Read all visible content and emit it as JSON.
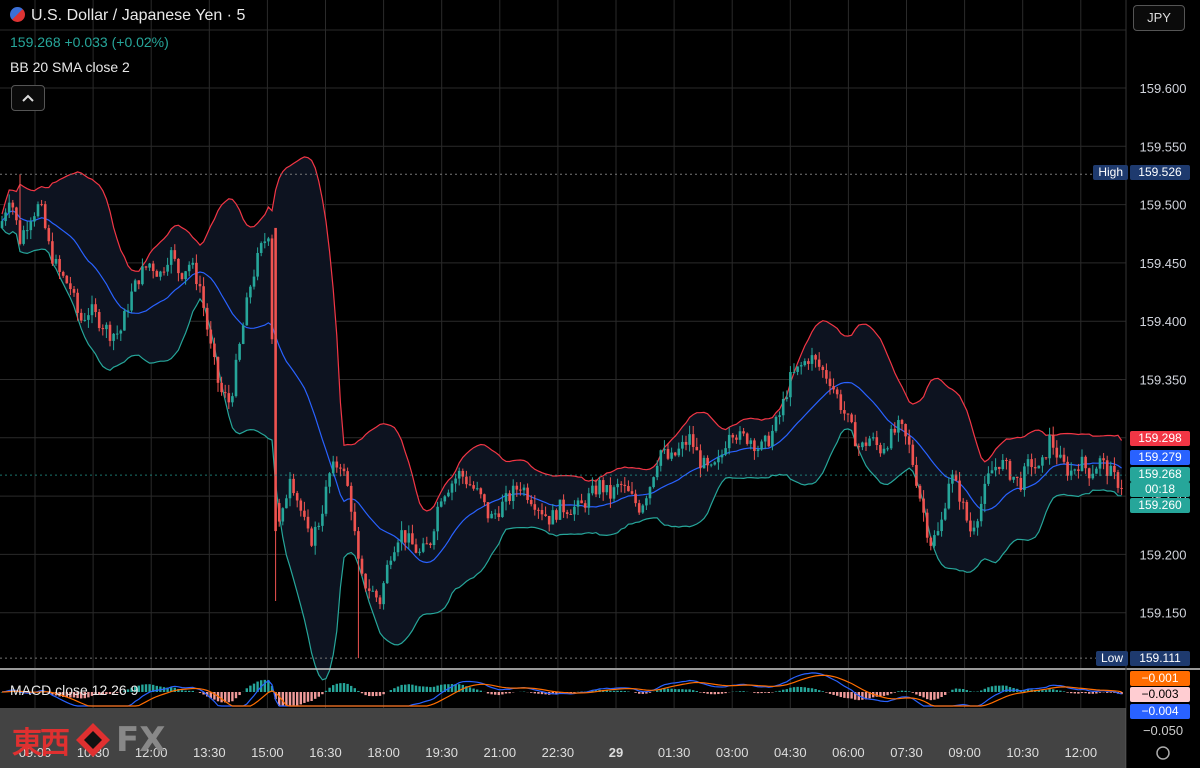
{
  "header": {
    "symbol": "U.S. Dollar / Japanese Yen · 5",
    "price": "159.268",
    "change": "+0.033 (+0.02%)",
    "indicator": "BB 20 SMA close 2",
    "collapse_icon": "chevron-up-icon"
  },
  "currency_button": "JPY",
  "watermark": {
    "kanji": "東西",
    "text": "FX"
  },
  "colors": {
    "up": "#26a69a",
    "down": "#ef5350",
    "upper_band": "#f23645",
    "lower_band": "#26a69a",
    "basis": "#2962ff",
    "macd": "#2962ff",
    "signal": "#ff6d00"
  },
  "chart_data": [
    {
      "type": "candlestick",
      "title": "U.S. Dollar / Japanese Yen · 5",
      "ylim": [
        159.1,
        159.64
      ],
      "y_ticks": [
        "159.600",
        "159.550",
        "159.500",
        "159.450",
        "159.400",
        "159.350",
        "159.300",
        "159.250",
        "159.200",
        "159.150"
      ],
      "x_ticks": [
        "09:00",
        "10:30",
        "12:00",
        "13:30",
        "15:00",
        "16:30",
        "18:00",
        "19:30",
        "21:00",
        "22:30",
        "29",
        "01:30",
        "03:00",
        "04:30",
        "06:00",
        "07:30",
        "09:00",
        "10:30",
        "12:00"
      ],
      "high": {
        "label": "High",
        "value": "159.526"
      },
      "low": {
        "label": "Low",
        "value": "159.111"
      },
      "price_labels": {
        "upper_band": "159.298",
        "basis": "159.279",
        "last": "159.268",
        "countdown": "00:18",
        "lower_band": "159.260"
      },
      "close_path": [
        [
          0,
          159.48
        ],
        [
          10,
          159.51
        ],
        [
          20,
          159.47
        ],
        [
          30,
          159.49
        ],
        [
          40,
          159.5
        ],
        [
          50,
          159.46
        ],
        [
          60,
          159.44
        ],
        [
          70,
          159.43
        ],
        [
          80,
          159.4
        ],
        [
          90,
          159.41
        ],
        [
          100,
          159.4
        ],
        [
          110,
          159.39
        ],
        [
          120,
          159.39
        ],
        [
          130,
          159.42
        ],
        [
          140,
          159.44
        ],
        [
          150,
          159.45
        ],
        [
          160,
          159.44
        ],
        [
          170,
          159.46
        ],
        [
          180,
          159.44
        ],
        [
          190,
          159.45
        ],
        [
          200,
          159.43
        ],
        [
          210,
          159.38
        ],
        [
          220,
          159.34
        ],
        [
          230,
          159.33
        ],
        [
          240,
          159.38
        ],
        [
          250,
          159.43
        ],
        [
          260,
          159.46
        ],
        [
          270,
          159.48
        ],
        [
          275,
          159.25
        ],
        [
          280,
          159.22
        ],
        [
          290,
          159.27
        ],
        [
          300,
          159.24
        ],
        [
          310,
          159.21
        ],
        [
          320,
          159.23
        ],
        [
          330,
          159.27
        ],
        [
          340,
          159.28
        ],
        [
          350,
          159.25
        ],
        [
          360,
          159.18
        ],
        [
          370,
          159.17
        ],
        [
          380,
          159.16
        ],
        [
          390,
          159.2
        ],
        [
          400,
          159.22
        ],
        [
          410,
          159.21
        ],
        [
          420,
          159.2
        ],
        [
          430,
          159.21
        ],
        [
          440,
          159.25
        ],
        [
          450,
          159.26
        ],
        [
          460,
          159.27
        ],
        [
          470,
          159.26
        ],
        [
          480,
          159.25
        ],
        [
          490,
          159.23
        ],
        [
          500,
          159.24
        ],
        [
          510,
          159.25
        ],
        [
          520,
          159.26
        ],
        [
          530,
          159.25
        ],
        [
          540,
          159.24
        ],
        [
          550,
          159.23
        ],
        [
          560,
          159.24
        ],
        [
          570,
          159.24
        ],
        [
          580,
          159.24
        ],
        [
          590,
          159.25
        ],
        [
          600,
          159.26
        ],
        [
          610,
          159.25
        ],
        [
          620,
          159.26
        ],
        [
          630,
          159.25
        ],
        [
          640,
          159.24
        ],
        [
          650,
          159.26
        ],
        [
          660,
          159.29
        ],
        [
          670,
          159.28
        ],
        [
          680,
          159.29
        ],
        [
          690,
          159.3
        ],
        [
          700,
          159.28
        ],
        [
          710,
          159.27
        ],
        [
          720,
          159.28
        ],
        [
          730,
          159.31
        ],
        [
          740,
          159.3
        ],
        [
          750,
          159.3
        ],
        [
          760,
          159.29
        ],
        [
          770,
          159.3
        ],
        [
          780,
          159.32
        ],
        [
          790,
          159.35
        ],
        [
          800,
          159.36
        ],
        [
          810,
          159.37
        ],
        [
          820,
          159.36
        ],
        [
          830,
          159.35
        ],
        [
          840,
          159.33
        ],
        [
          850,
          159.31
        ],
        [
          860,
          159.29
        ],
        [
          870,
          159.3
        ],
        [
          880,
          159.29
        ],
        [
          890,
          159.3
        ],
        [
          900,
          159.31
        ],
        [
          910,
          159.29
        ],
        [
          920,
          159.25
        ],
        [
          930,
          159.21
        ],
        [
          940,
          159.22
        ],
        [
          950,
          159.27
        ],
        [
          960,
          159.25
        ],
        [
          970,
          159.22
        ],
        [
          980,
          159.24
        ],
        [
          990,
          159.27
        ],
        [
          1000,
          159.28
        ],
        [
          1010,
          159.27
        ],
        [
          1020,
          159.26
        ],
        [
          1030,
          159.28
        ],
        [
          1040,
          159.27
        ],
        [
          1050,
          159.3
        ],
        [
          1060,
          159.28
        ],
        [
          1070,
          159.27
        ],
        [
          1080,
          159.28
        ],
        [
          1090,
          159.27
        ],
        [
          1100,
          159.28
        ],
        [
          1110,
          159.27
        ],
        [
          1120,
          159.26
        ]
      ]
    },
    {
      "type": "macd",
      "title": "MACD close 12 26 9",
      "y_ticks": [
        "−0.050"
      ],
      "value_labels": [
        "−0.001",
        "−0.003",
        "−0.004"
      ]
    }
  ]
}
